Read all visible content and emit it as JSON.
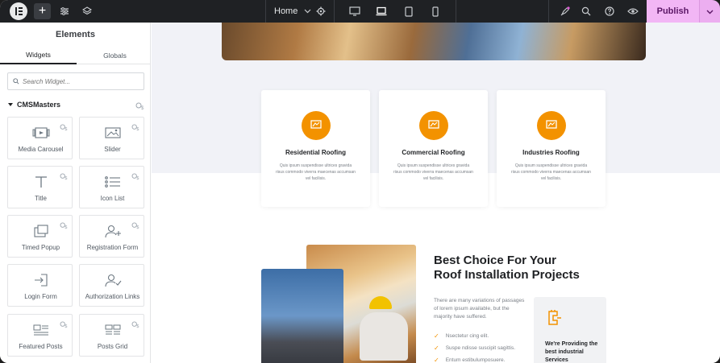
{
  "topbar": {
    "page_name": "Home",
    "publish_label": "Publish"
  },
  "sidebar": {
    "title": "Elements",
    "tabs": [
      {
        "label": "Widgets",
        "active": true
      },
      {
        "label": "Globals",
        "active": false
      }
    ],
    "search_placeholder": "Search Widget...",
    "category": "CMSMasters",
    "widgets": [
      {
        "label": "Media Carousel",
        "icon": "media-carousel-icon"
      },
      {
        "label": "Slider",
        "icon": "slider-icon"
      },
      {
        "label": "Title",
        "icon": "title-icon"
      },
      {
        "label": "Icon List",
        "icon": "icon-list-icon"
      },
      {
        "label": "Timed Popup",
        "icon": "timed-popup-icon"
      },
      {
        "label": "Registration Form",
        "icon": "registration-form-icon"
      },
      {
        "label": "Login Form",
        "icon": "login-form-icon"
      },
      {
        "label": "Authorization Links",
        "icon": "authorization-links-icon"
      },
      {
        "label": "Featured Posts",
        "icon": "featured-posts-icon"
      },
      {
        "label": "Posts Grid",
        "icon": "posts-grid-icon"
      }
    ]
  },
  "canvas": {
    "services": [
      {
        "title": "Residential Roofing",
        "text": "Quis ipsum suspendisse ultrices gravida risus commodo viverra maecenas accumsan vel facilisis."
      },
      {
        "title": "Commercial Roofing",
        "text": "Quis ipsum suspendisse ultrices gravida risus commodo viverra maecenas accumsan vel facilisis."
      },
      {
        "title": "Industries Roofing",
        "text": "Quis ipsum suspendisse ultrices gravida risus commodo viverra maecenas accumsan vel facilisis."
      }
    ],
    "heading_line1": "Best Choice For Your",
    "heading_line2": "Roof Installation Projects",
    "paragraph": "There are many variations of passages of lorem ipsum available, but the majority have suffered.",
    "list": [
      "Nsectetur cing elit.",
      "Suspe ndisse suscipit sagittis.",
      "Entum estibulumposuere."
    ],
    "card_text": "We're Providing the best industrial Services"
  },
  "colors": {
    "accent": "#f39200",
    "publish_bg": "#f2b6f5",
    "topbar_bg": "#1f2124"
  }
}
